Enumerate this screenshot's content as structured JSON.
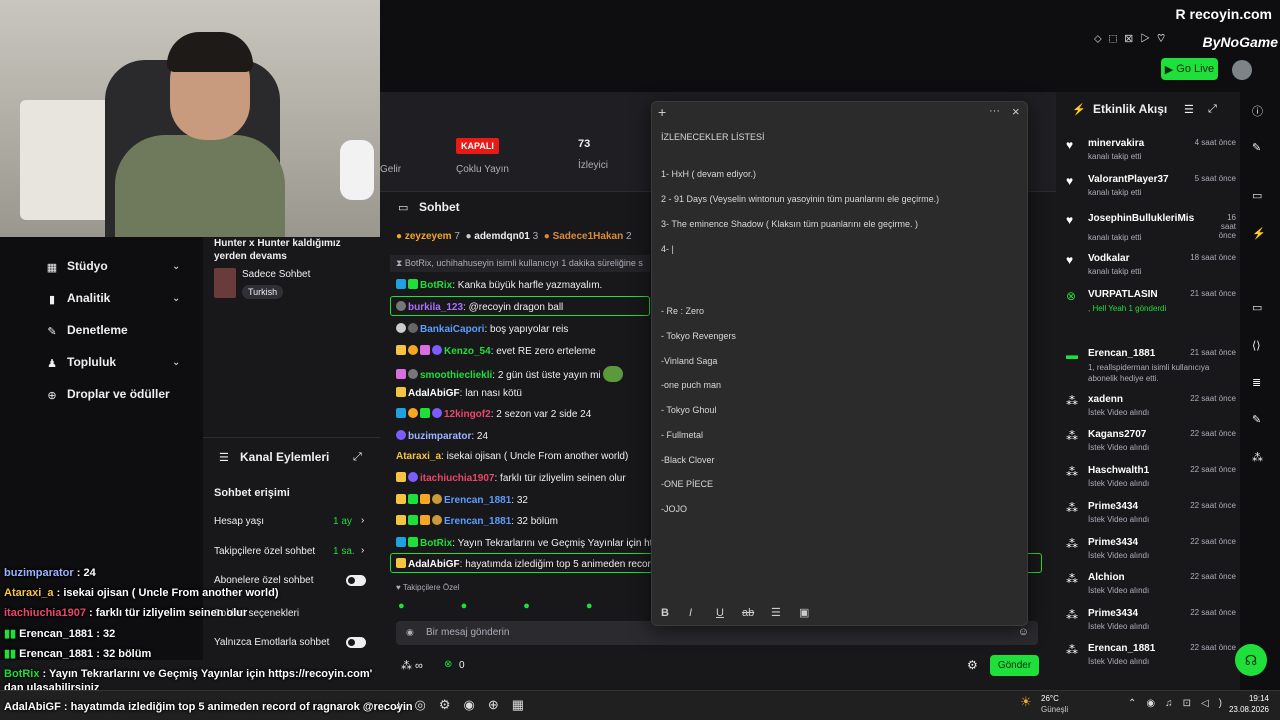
{
  "brand": {
    "name": "recoyin.com",
    "sponsor": "ByNoGame",
    "go_live": "Go Live"
  },
  "stats": {
    "gelir": "Gelir",
    "status_badge": "KAPALI",
    "mode": "Çoklu Yayın",
    "viewers": "73",
    "viewers_label": "İzleyici"
  },
  "leftnav": {
    "items": [
      {
        "label": "Stüdyo",
        "icon": "grid-icon"
      },
      {
        "label": "Analitik",
        "icon": "chart-icon"
      },
      {
        "label": "Denetleme",
        "icon": "wrench-icon"
      },
      {
        "label": "Topluluk",
        "icon": "community-icon"
      },
      {
        "label": "Droplar ve ödüller",
        "icon": "gift-icon"
      }
    ]
  },
  "stream": {
    "title": "Hunter x Hunter kaldığımız yerden devams",
    "category": "Sadece Sohbet",
    "tag": "Turkish"
  },
  "channel_actions": {
    "title": "Kanal Eylemleri",
    "section": "Sohbet erişimi",
    "rows": [
      {
        "label": "Hesap yaşı",
        "value": "1 ay"
      },
      {
        "label": "Takipçilere özel sohbet",
        "value": "1 sa."
      },
      {
        "label": "Abonelere özel sohbet",
        "value": ""
      },
      {
        "label": "Sohbet seçenekleri",
        "value": ""
      },
      {
        "label": "Yalnızca Emotlarla sohbet",
        "value": ""
      }
    ]
  },
  "chat": {
    "title": "Sohbet",
    "top_gifters": [
      "zeyzeyem",
      "7",
      "ademdqn01",
      "3",
      "Sadece1Hakan",
      "2"
    ],
    "system": "BotRix, uchihahuseyin isimli kullanıcıyı 1 dakika süreliğine s",
    "messages": [
      {
        "user": "BotRix",
        "text": "Kanka büyük harfle yazmayalım.",
        "color": "#1fdf3a"
      },
      {
        "user": "burkila_123",
        "text": "@recoyin dragon ball",
        "color": "#a970ff"
      },
      {
        "user": "BankaiCapori",
        "text": "boş yapıyolar reis",
        "color": "#5c9dff"
      },
      {
        "user": "Kenzo_54",
        "text": "evet RE zero erteleme",
        "color": "#1fdf3a"
      },
      {
        "user": "smoothiecliekli",
        "text": "2 gün üst üste yayın mi",
        "color": "#1fdf3a"
      },
      {
        "user": "AdalAbiGF",
        "text": "lan nası kötü",
        "color": "#ffffff"
      },
      {
        "user": "12kingof2",
        "text": "2 sezon var 2 side 24",
        "color": "#e9476b"
      },
      {
        "user": "buzimparator",
        "text": "24",
        "color": "#9cb4ff"
      },
      {
        "user": "Ataraxi_a",
        "text": "isekai ojisan ( Uncle From another world)",
        "color": "#f5c542"
      },
      {
        "user": "itachiuchia1907",
        "text": "farklı tür izliyelim seinen olur",
        "color": "#e9476b"
      },
      {
        "user": "Erencan_1881",
        "text": "32",
        "color": "#5c9dff"
      },
      {
        "user": "Erencan_1881",
        "text": "32 bölüm",
        "color": "#5c9dff"
      },
      {
        "user": "BotRix",
        "text": "Yayın Tekrarlarını ve Geçmiş Yayınlar için ht",
        "color": "#1fdf3a"
      },
      {
        "user": "AdalAbiGF",
        "text": "hayatımda izlediğim top 5 animeden record",
        "color": "#ffffff"
      }
    ],
    "followers_only": "Takipçilere Özel",
    "placeholder": "Bir mesaj gönderin",
    "points": "0",
    "send": "Gönder"
  },
  "notepad": {
    "lines": [
      "İZLENECEKLER LİSTESİ",
      "1- HxH ( devam ediyor.)",
      "2 - 91 Days  (Veyselin wintonun yasoyinin tüm puanlarını ele geçirme.)",
      "3- The eminence Shadow  ( Klaksın tüm puanlarını ele geçirme. )",
      "4- |",
      "-  Re : Zero",
      "- Tokyo Revengers",
      "-Vinland Saga",
      "-one puch man",
      "- Tokyo Ghoul",
      "- Fullmetal",
      "-Black Clover",
      "-ONE PİECE",
      "-JOJO"
    ]
  },
  "activity": {
    "title": "Etkinlik Akışı",
    "items": [
      {
        "name": "minervakira",
        "sub": "kanalı takip etti",
        "time": "4 saat önce"
      },
      {
        "name": "ValorantPlayer37",
        "sub": "kanalı takip etti",
        "time": "5 saat önce"
      },
      {
        "name": "JosephinBullukleriMis",
        "sub": "kanalı takip etti",
        "time": "16 saat önce"
      },
      {
        "name": "Vodkalar",
        "sub": "kanalı takip etti",
        "time": "18 saat önce"
      },
      {
        "name": "VURPATLASIN",
        "sub": ", Hell Yeah  1 gönderdi",
        "time": "21 saat önce"
      },
      {
        "name": "Erencan_1881",
        "sub": "1, reallspiderman isimli kullanıcıya abonelik hediye etti.",
        "time": "21 saat önce"
      },
      {
        "name": "xadenn",
        "sub": "İstek Video alındı",
        "time": "22 saat önce"
      },
      {
        "name": "Kagans2707",
        "sub": "İstek Video alındı",
        "time": "22 saat önce"
      },
      {
        "name": "Haschwalth1",
        "sub": "İstek Video alındı",
        "time": "22 saat önce"
      },
      {
        "name": "Prime3434",
        "sub": "İstek Video alındı",
        "time": "22 saat önce"
      },
      {
        "name": "Prime3434",
        "sub": "İstek Video alındı",
        "time": "22 saat önce"
      },
      {
        "name": "Alchion",
        "sub": "İstek Video alındı",
        "time": "22 saat önce"
      },
      {
        "name": "Prime3434",
        "sub": "İstek Video alındı",
        "time": "22 saat önce"
      },
      {
        "name": "Erencan_1881",
        "sub": "İstek Video alındı",
        "time": "22 saat önce"
      }
    ]
  },
  "overlay_chat": [
    {
      "user": "buzimparator",
      "text": " : 24"
    },
    {
      "user": "Ataraxi_a",
      "text": " : isekai ojisan ( Uncle From another world)"
    },
    {
      "user": "itachiuchia1907",
      "text": " : farklı tür izliyelim seinen olur"
    },
    {
      "user": "Erencan_1881",
      "text": " : 32"
    },
    {
      "user": "Erencan_1881",
      "text": " : 32 bölüm"
    },
    {
      "user": "BotRix",
      "text": " : Yayın Tekrarlarını ve Geçmiş Yayınlar için https://recoyin.com' dan ulaşabilirsiniz"
    },
    {
      "user": "AdalAbiGF",
      "text": " : hayatımda izlediğim top 5 animeden record of ragnarok @recoyin"
    }
  ],
  "taskbar": {
    "weather": "26°C",
    "weather_label": "Güneşli",
    "time": "19:14",
    "date": "23.08.2026"
  }
}
